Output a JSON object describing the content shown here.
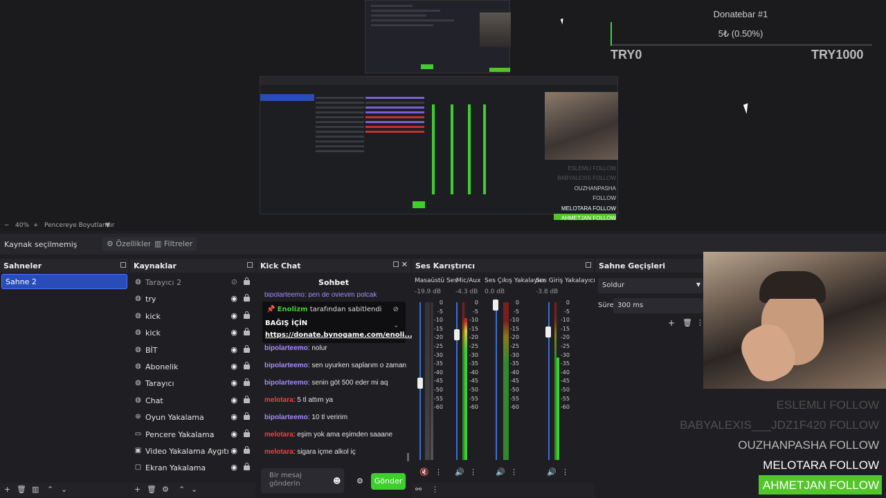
{
  "preview": {
    "donatebar": {
      "title": "Donatebar #1",
      "progress_text": "5₺ (0.50%)",
      "progress_fraction": 0.005,
      "min_label": "TRY0",
      "max_label": "TRY1000"
    },
    "nested_follows": [
      "ESLEMLI FOLLOW",
      "BABYALEXIS FOLLOW",
      "OUZHANPASHA FOLLOW",
      "MELOTARA FOLLOW",
      "AHMETJAN FOLLOW"
    ]
  },
  "preview_toolbar": {
    "zoom": "40%",
    "fit_label": "Pencereye Boyutlandır"
  },
  "source_bar": {
    "no_source": "Kaynak seçilmemiş",
    "properties": "Özellikler",
    "filters": "Filtreler"
  },
  "scenes": {
    "title": "Sahneler",
    "items": [
      "Sahne 2"
    ]
  },
  "sources": {
    "title": "Kaynaklar",
    "items": [
      {
        "label": "Tarayıcı 2",
        "icon": "globe-icon",
        "hidden": true
      },
      {
        "label": "try",
        "icon": "globe-icon"
      },
      {
        "label": "kick",
        "icon": "globe-icon"
      },
      {
        "label": "kick",
        "icon": "globe-icon"
      },
      {
        "label": "BİT",
        "icon": "globe-icon"
      },
      {
        "label": "Abonelik",
        "icon": "globe-icon"
      },
      {
        "label": "Tarayıcı",
        "icon": "globe-icon"
      },
      {
        "label": "Chat",
        "icon": "globe-icon"
      },
      {
        "label": "Oyun Yakalama",
        "icon": "gamepad-icon"
      },
      {
        "label": "Pencere Yakalama",
        "icon": "window-icon"
      },
      {
        "label": "Video Yakalama Aygıtı",
        "icon": "camera-icon"
      },
      {
        "label": "Ekran Yakalama",
        "icon": "monitor-icon"
      }
    ]
  },
  "kick_chat": {
    "title": "Kick Chat",
    "header": "Sohbet",
    "partial_top": "bipolarteemo: pen de ovievim polcak",
    "pinned": {
      "by_user": "Enolizm",
      "by_text": "tarafından sabitlendi",
      "title": "BAĞIŞ İÇİN",
      "link": "https://donate.bynogame.com/enoli..."
    },
    "messages": [
      {
        "user": "bipolarteemo",
        "text": "nolur",
        "color": "purple"
      },
      {
        "user": "bipolarteemo",
        "text": "sen uyurken saplarım o zaman",
        "color": "purple"
      },
      {
        "user": "bipolarteemo",
        "text": "senin göt 500 eder mi aq",
        "color": "purple"
      },
      {
        "user": "melotara",
        "text": "5 tl attım ya",
        "color": "red"
      },
      {
        "user": "bipolarteemo",
        "text": "10 tl veririm",
        "color": "purple"
      },
      {
        "user": "melotara",
        "text": "eşim yok ama eşimden saaane",
        "color": "red"
      },
      {
        "user": "melotara",
        "text": "sigara içme alkol iç",
        "color": "red"
      }
    ],
    "input_placeholder_1": "Bir mesaj",
    "input_placeholder_2": "gönderin",
    "send": "Gönder"
  },
  "mixer": {
    "title": "Ses Karıştırıcı",
    "channels": [
      {
        "name": "Masaüstü Ses",
        "db": "-19.9 dB",
        "muted": true
      },
      {
        "name": "Mic/Aux",
        "db": "-4.3 dB",
        "muted": false
      },
      {
        "name": "Ses Çıkış Yakalayıcı",
        "db": "0.0 dB",
        "muted": false
      },
      {
        "name": "Ses Giriş Yakalayıcı",
        "db": "-3.8 dB",
        "muted": false
      }
    ],
    "scale": [
      "0",
      "-5",
      "-10",
      "-15",
      "-20",
      "-25",
      "-30",
      "-35",
      "-40",
      "-45",
      "-50",
      "-55",
      "-60"
    ]
  },
  "transitions": {
    "title": "Sahne Geçişleri",
    "selected": "Soldur",
    "duration_label": "Süre",
    "duration_value": "300 ms"
  },
  "overlay_follows": [
    {
      "text": "ESLEMLI   FOLLOW",
      "style": "faded"
    },
    {
      "text": "BABYALEXIS___JDZ1F420   FOLLOW",
      "style": "faded"
    },
    {
      "text": "OUZHANPASHA   FOLLOW",
      "style": "mid"
    },
    {
      "text": "MELOTARA   FOLLOW",
      "style": "bright"
    },
    {
      "text": "AHMETJAN   FOLLOW",
      "style": "green"
    }
  ],
  "colors": {
    "accent_blue": "#284cb8",
    "send_green": "#3ecf2e",
    "follow_green": "#53c52a",
    "user_purple": "#a58bff",
    "user_red": "#ff3b3b"
  }
}
